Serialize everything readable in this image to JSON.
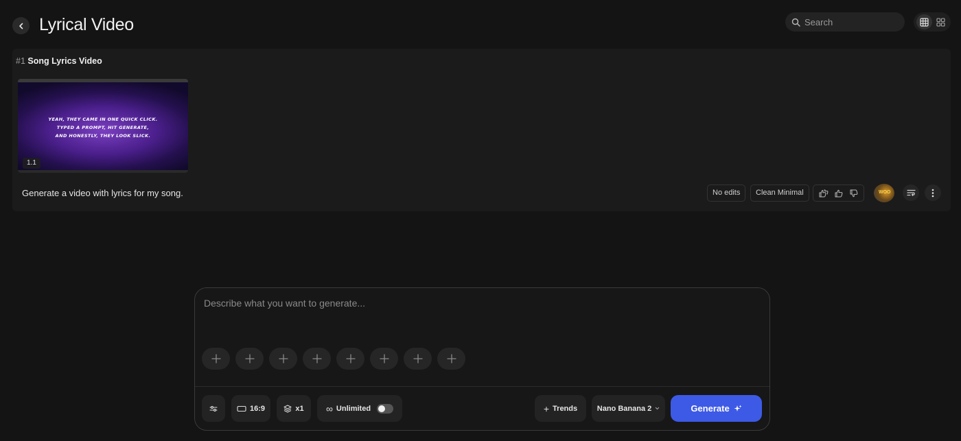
{
  "header": {
    "title": "Lyrical Video",
    "search_placeholder": "Search"
  },
  "card": {
    "number": "#1",
    "title": "Song Lyrics Video",
    "thumbnail": {
      "lyric_lines": [
        "Yeah, they came in one quick click.",
        "Typed a prompt, hit generate,",
        "and honestly, they look slick."
      ],
      "badge": "1.1"
    },
    "prompt": "Generate a video with lyrics for my song.",
    "chips": [
      "No edits",
      "Clean Minimal"
    ],
    "avatar_text": "WOO"
  },
  "composer": {
    "placeholder": "Describe what you want to generate...",
    "slot_count": 8,
    "aspect_ratio": "16:9",
    "count": "x1",
    "unlimited_label": "Unlimited",
    "unlimited_on": false,
    "trends_label": "Trends",
    "model_label": "Nano Banana 2",
    "generate_label": "Generate"
  },
  "colors": {
    "background": "#141414",
    "card": "#1b1b1b",
    "accent": "#3d5ae6"
  }
}
